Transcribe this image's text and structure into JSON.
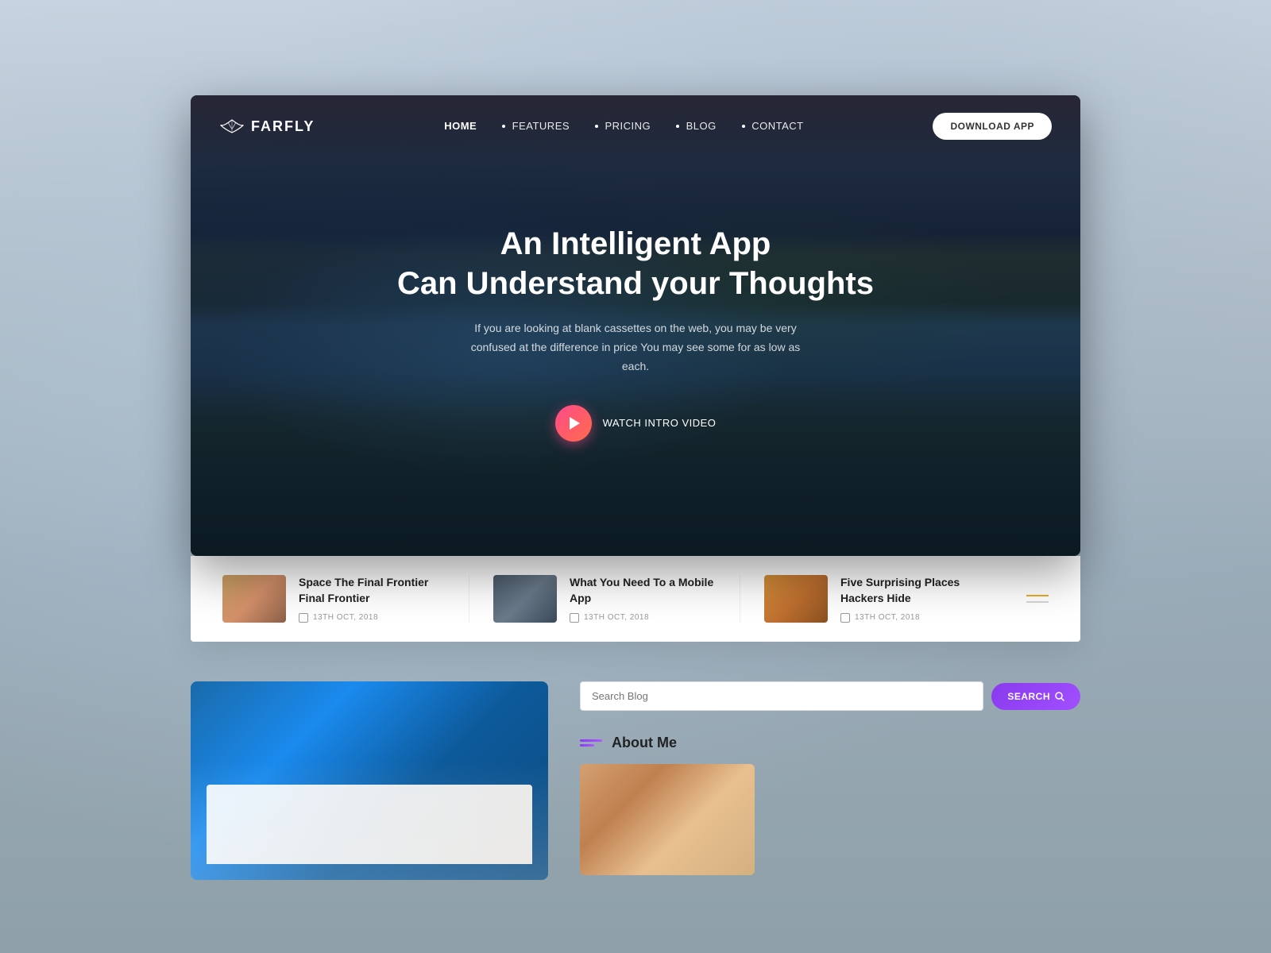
{
  "brand": {
    "name": "FARFLY",
    "logo_alt": "farfly logo"
  },
  "nav": {
    "links": [
      {
        "label": "HOME",
        "active": true
      },
      {
        "label": "FEATURES",
        "active": false
      },
      {
        "label": "PRICING",
        "active": false
      },
      {
        "label": "BLOG",
        "active": false
      },
      {
        "label": "CONTACT",
        "active": false
      }
    ],
    "cta_label": "DOWNLOAD APP"
  },
  "hero": {
    "title": "An Intelligent App\nCan Understand your Thoughts",
    "subtitle": "If you are looking at blank cassettes on the web, you may be very confused at the difference in price You may see some for as low as each.",
    "watch_label": "WATCH INTRO VIDEO"
  },
  "blog_cards": [
    {
      "title": "Space The Final Frontier Final Frontier",
      "date": "13TH OCT, 2018"
    },
    {
      "title": "What You Need To a Mobile App",
      "date": "13TH OCT, 2018"
    },
    {
      "title": "Five Surprising Places Hackers Hide",
      "date": "13TH OCT, 2018"
    }
  ],
  "sidebar": {
    "search_placeholder": "Search Blog",
    "search_btn": "SEARCH",
    "about_title": "About Me"
  }
}
